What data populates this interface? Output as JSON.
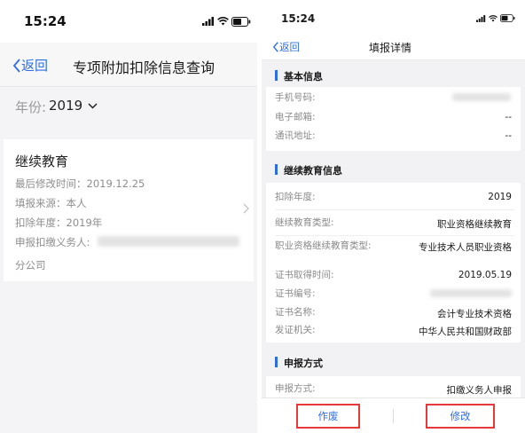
{
  "left": {
    "status_time": "15:24",
    "back_label": "返回",
    "title": "专项附加扣除信息查询",
    "year_label": "年份:",
    "year_value": "2019",
    "card": {
      "title": "继续教育",
      "last_modified": "最后修改时间：2019.12.25",
      "source": "填报来源：本人",
      "deduct_year": "扣除年度：2019年",
      "withholding_agent_label": "申报扣缴义务人:",
      "branch_suffix": "分公司"
    }
  },
  "right": {
    "status_time": "15:24",
    "back_label": "返回",
    "title": "填报详情",
    "sections": {
      "basic": {
        "heading": "基本信息",
        "phone_label": "手机号码:",
        "email_label": "电子邮箱:",
        "email_value": "--",
        "address_label": "通讯地址:",
        "address_value": "--"
      },
      "edu": {
        "heading": "继续教育信息",
        "year_label": "扣除年度:",
        "year_value": "2019",
        "type_label": "继续教育类型:",
        "type_value": "职业资格继续教育",
        "qual_type_label": "职业资格继续教育类型:",
        "qual_type_value": "专业技术人员职业资格",
        "cert_date_label": "证书取得时间:",
        "cert_date_value": "2019.05.19",
        "cert_no_label": "证书编号:",
        "cert_name_label": "证书名称:",
        "cert_name_value": "会计专业技术资格",
        "issuer_label": "发证机关:",
        "issuer_value": "中华人民共和国财政部"
      },
      "declare": {
        "heading": "申报方式",
        "method_label": "申报方式:",
        "method_value": "扣缴义务人申报"
      }
    },
    "void_button": "作废",
    "edit_button": "修改"
  },
  "colors": {
    "accent": "#2f6de5",
    "highlight": "#e63a3a"
  },
  "icons": [
    "signal-icon",
    "wifi-icon",
    "battery-icon",
    "chevron-left-icon",
    "chevron-down-icon",
    "chevron-right-icon"
  ]
}
